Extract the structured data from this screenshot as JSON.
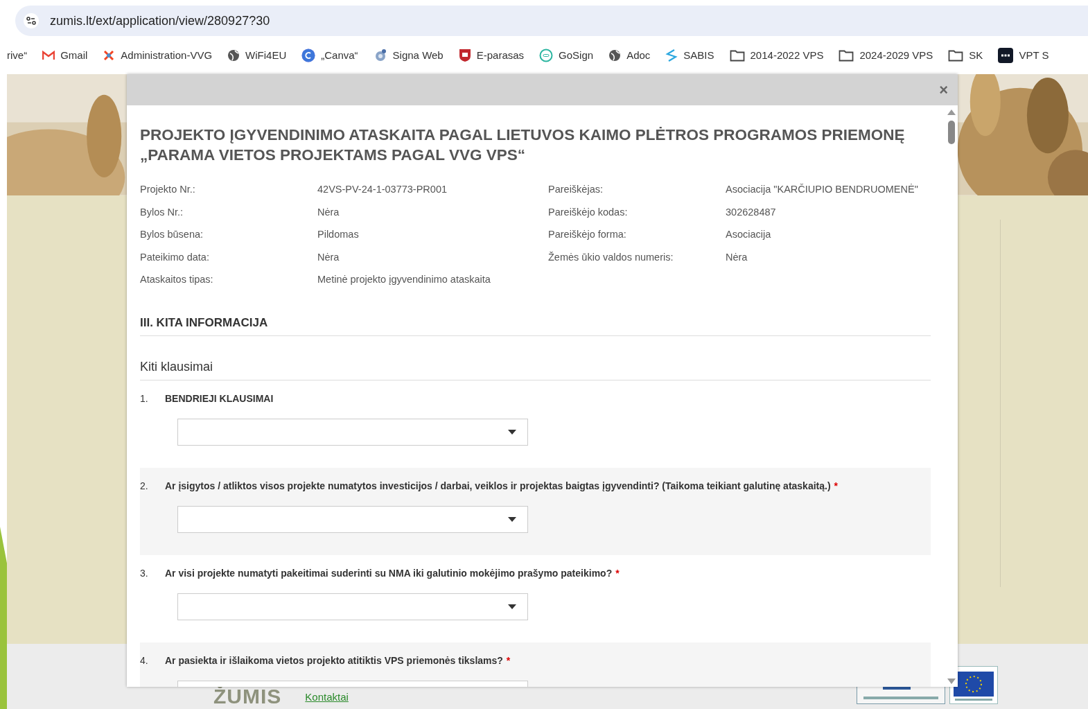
{
  "browser": {
    "url": "zumis.lt/ext/application/view/280927?30",
    "bookmarks": [
      {
        "label": "rive“",
        "kind": "cut"
      },
      {
        "label": "Gmail",
        "kind": "mail"
      },
      {
        "label": "Administration-VVG",
        "kind": "cross"
      },
      {
        "label": "WiFi4EU",
        "kind": "globe"
      },
      {
        "label": "„Canva“",
        "kind": "circle"
      },
      {
        "label": "Signa Web",
        "kind": "gear"
      },
      {
        "label": "E-parasas",
        "kind": "shield"
      },
      {
        "label": "GoSign",
        "kind": "ring"
      },
      {
        "label": "Adoc",
        "kind": "globe"
      },
      {
        "label": "SABIS",
        "kind": "swirl"
      },
      {
        "label": "2014-2022 VPS",
        "kind": "folder"
      },
      {
        "label": "2024-2029 VPS",
        "kind": "folder"
      },
      {
        "label": "SK",
        "kind": "folder"
      },
      {
        "label": "VPT S",
        "kind": "sso"
      }
    ]
  },
  "footer": {
    "logo": "ŽUMIS",
    "link": "Kontaktai"
  },
  "modal": {
    "close": "×",
    "title": "PROJEKTO ĮGYVENDINIMO ATASKAITA PAGAL LIETUVOS KAIMO PLĖTROS PROGRAMOS PRIEMONĘ „PARAMA VIETOS PROJEKTAMS PAGAL VVG VPS“",
    "info": [
      {
        "label": "Projekto Nr.:",
        "value": "42VS-PV-24-1-03773-PR001"
      },
      {
        "label": "Pareiškėjas:",
        "value": "Asociacija \"KARČIUPIO BENDRUOMENĖ\""
      },
      {
        "label": "Bylos Nr.:",
        "value": "Nėra"
      },
      {
        "label": "Pareiškėjo kodas:",
        "value": "302628487"
      },
      {
        "label": "Bylos būsena:",
        "value": "Pildomas"
      },
      {
        "label": "Pareiškėjo forma:",
        "value": "Asociacija"
      },
      {
        "label": "Pateikimo data:",
        "value": "Nėra"
      },
      {
        "label": "Žemės ūkio valdos numeris:",
        "value": "Nėra"
      },
      {
        "label": "Ataskaitos tipas:",
        "value": "Metinė projekto įgyvendinimo ataskaita"
      }
    ],
    "section": "III. KITA INFORMACIJA",
    "subsection": "Kiti klausimai",
    "questions": [
      {
        "number": "1.",
        "text": "BENDRIEJI KLAUSIMAI"
      },
      {
        "number": "2.",
        "text": "Ar įsigytos / atliktos visos projekte numatytos investicijos / darbai, veiklos ir projektas baigtas įgyvendinti? (Taikoma teikiant galutinę ataskaitą.)",
        "required_mark": "*"
      },
      {
        "number": "3.",
        "text": "Ar visi projekte numatyti pakeitimai suderinti su NMA iki galutinio mokėjimo prašymo pateikimo?",
        "required_mark": "*"
      },
      {
        "number": "4.",
        "text": "Ar pasiekta ir išlaikoma vietos projekto atitiktis VPS priemonės tikslams?",
        "required_mark": "*"
      }
    ]
  }
}
